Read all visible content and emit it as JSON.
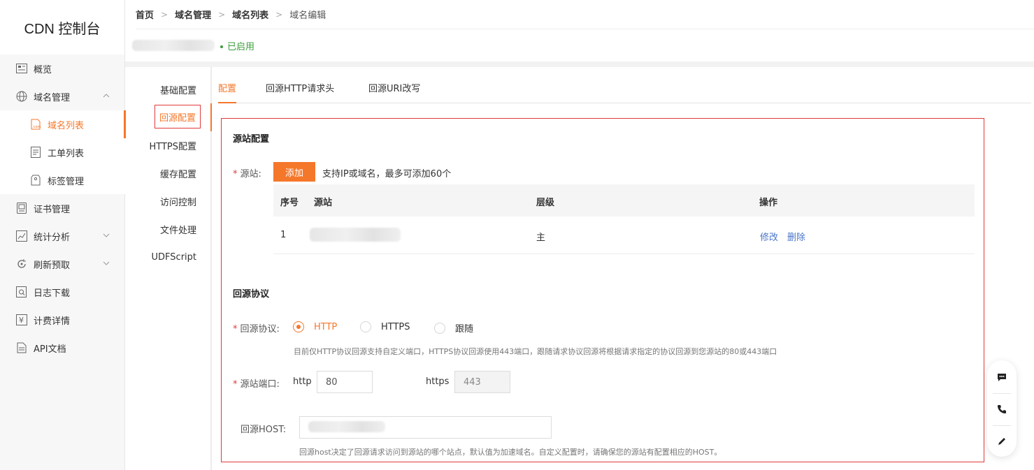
{
  "sidebar": {
    "brand": "CDN 控制台",
    "items": [
      {
        "label": "概览",
        "icon": "overview-icon"
      },
      {
        "label": "域名管理",
        "icon": "globe-icon",
        "expanded": true
      },
      {
        "label": "域名列表",
        "icon": "domain-list-icon",
        "active": true
      },
      {
        "label": "工单列表",
        "icon": "ticket-icon"
      },
      {
        "label": "标签管理",
        "icon": "tag-icon"
      },
      {
        "label": "证书管理",
        "icon": "certificate-icon"
      },
      {
        "label": "统计分析",
        "icon": "chart-icon"
      },
      {
        "label": "刷新预取",
        "icon": "refresh-icon"
      },
      {
        "label": "日志下载",
        "icon": "log-icon"
      },
      {
        "label": "计费详情",
        "icon": "billing-icon"
      },
      {
        "label": "API文档",
        "icon": "doc-icon"
      }
    ]
  },
  "breadcrumb": [
    "首页",
    "域名管理",
    "域名列表",
    "域名编辑"
  ],
  "domain_status": "已启用",
  "settings_menu": [
    "基础配置",
    "回源配置",
    "HTTPS配置",
    "缓存配置",
    "访问控制",
    "文件处理",
    "UDFScript"
  ],
  "tabs": [
    "配置",
    "回源HTTP请求头",
    "回源URI改写"
  ],
  "origin_config": {
    "title": "源站配置",
    "origin_label": "源站:",
    "add_button": "添加",
    "add_hint": "支持IP或域名，最多可添加60个",
    "table": {
      "headers": [
        "序号",
        "源站",
        "层级",
        "操作"
      ],
      "rows": [
        {
          "index": "1",
          "level": "主",
          "edit": "修改",
          "delete": "删除"
        }
      ]
    }
  },
  "protocol_config": {
    "title": "回源协议",
    "protocol_label": "回源协议:",
    "options": [
      "HTTP",
      "HTTPS",
      "跟随"
    ],
    "selected": "HTTP",
    "protocol_hint": "目前仅HTTP协议回源支持自定义端口，HTTPS协议回源使用443端口，跟随请求协议回源将根据请求指定的协议回源到您源站的80或443端口",
    "port_label": "源站端口:",
    "http_label": "http",
    "http_port": "80",
    "https_label": "https",
    "https_port": "443",
    "host_label": "回源HOST:",
    "host_hint": "回源host决定了回源请求访问到源站的哪个站点，默认值为加速域名。自定义配置时，请确保您的源站有配置相应的HOST。"
  },
  "float_tools": [
    "chat-icon",
    "phone-icon",
    "edit-icon"
  ],
  "colors": {
    "accent": "#f5772a",
    "enabled": "#3b9d3b",
    "highlight_border": "#e03a3a",
    "link": "#4a76c8"
  }
}
